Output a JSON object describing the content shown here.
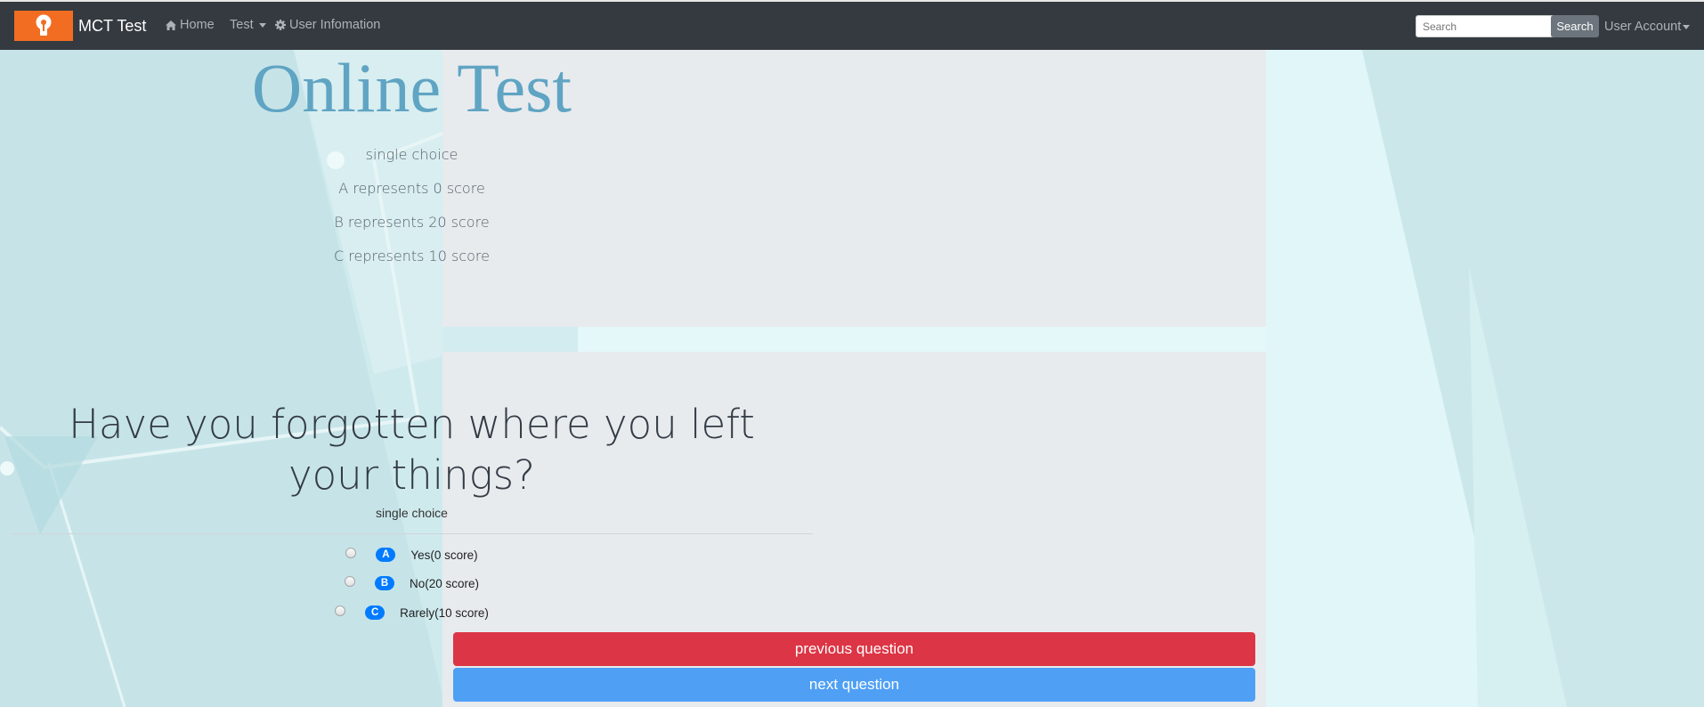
{
  "nav": {
    "brand": "MCT Test",
    "home": "Home",
    "test": "Test",
    "user_info": "User Infomation",
    "search_placeholder": "Search",
    "search_button": "Search",
    "account": "User Account",
    "logo_color": "#f26d21",
    "bar_color": "#343a40"
  },
  "intro": {
    "title": "Online Test",
    "lines": [
      "single choice",
      "A represents 0 score",
      "B represents 20 score",
      "C represents 10 score"
    ]
  },
  "question": {
    "text": "Have you forgotten where you left your things?",
    "type": "single choice",
    "options": [
      {
        "letter": "A",
        "label": "Yes(0 score)"
      },
      {
        "letter": "B",
        "label": "No(20 score)"
      },
      {
        "letter": "C",
        "label": "Rarely(10 score)"
      }
    ],
    "prev_button": "previous question",
    "next_button": "next question",
    "prev_color": "#dc3545",
    "next_color": "#4fa0f4",
    "badge_color": "#007bff"
  }
}
